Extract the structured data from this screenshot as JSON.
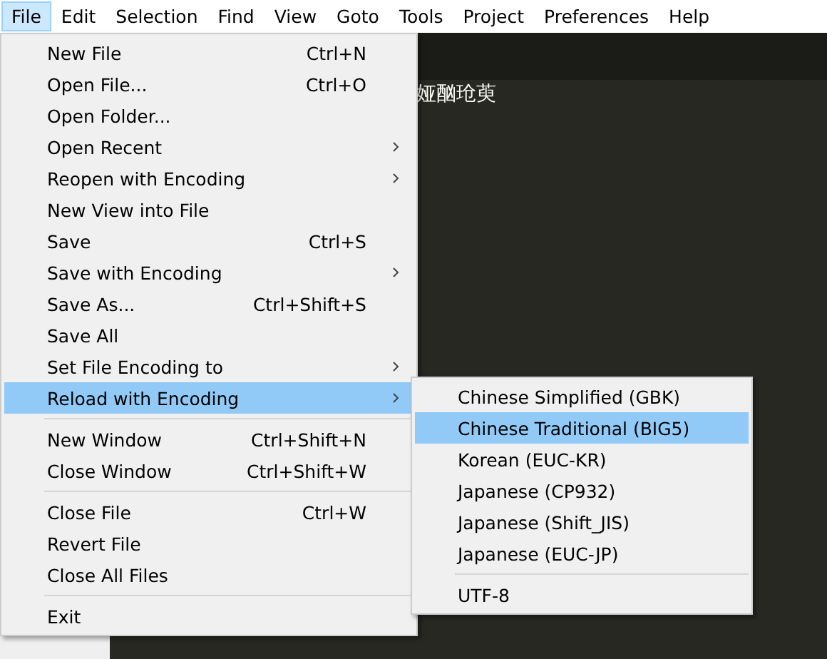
{
  "menubar": [
    {
      "label": "File",
      "selected": true
    },
    {
      "label": "Edit",
      "selected": false
    },
    {
      "label": "Selection",
      "selected": false
    },
    {
      "label": "Find",
      "selected": false
    },
    {
      "label": "View",
      "selected": false
    },
    {
      "label": "Goto",
      "selected": false
    },
    {
      "label": "Tools",
      "selected": false
    },
    {
      "label": "Project",
      "selected": false
    },
    {
      "label": "Preferences",
      "selected": false
    },
    {
      "label": "Help",
      "selected": false
    }
  ],
  "editor": {
    "text": "娅酗玱萸"
  },
  "file_menu": [
    {
      "kind": "item",
      "label": "New File",
      "shortcut": "Ctrl+N",
      "submenu": false,
      "selected": false
    },
    {
      "kind": "item",
      "label": "Open File...",
      "shortcut": "Ctrl+O",
      "submenu": false,
      "selected": false
    },
    {
      "kind": "item",
      "label": "Open Folder...",
      "submenu": false,
      "selected": false
    },
    {
      "kind": "item",
      "label": "Open Recent",
      "submenu": true,
      "selected": false
    },
    {
      "kind": "item",
      "label": "Reopen with Encoding",
      "submenu": true,
      "selected": false
    },
    {
      "kind": "item",
      "label": "New View into File",
      "submenu": false,
      "selected": false
    },
    {
      "kind": "item",
      "label": "Save",
      "shortcut": "Ctrl+S",
      "submenu": false,
      "selected": false
    },
    {
      "kind": "item",
      "label": "Save with Encoding",
      "submenu": true,
      "selected": false
    },
    {
      "kind": "item",
      "label": "Save As...",
      "shortcut": "Ctrl+Shift+S",
      "submenu": false,
      "selected": false
    },
    {
      "kind": "item",
      "label": "Save All",
      "submenu": false,
      "selected": false
    },
    {
      "kind": "item",
      "label": "Set File Encoding to",
      "submenu": true,
      "selected": false
    },
    {
      "kind": "item",
      "label": "Reload with Encoding",
      "submenu": true,
      "selected": true
    },
    {
      "kind": "separator"
    },
    {
      "kind": "item",
      "label": "New Window",
      "shortcut": "Ctrl+Shift+N",
      "submenu": false,
      "selected": false
    },
    {
      "kind": "item",
      "label": "Close Window",
      "shortcut": "Ctrl+Shift+W",
      "submenu": false,
      "selected": false
    },
    {
      "kind": "separator"
    },
    {
      "kind": "item",
      "label": "Close File",
      "shortcut": "Ctrl+W",
      "submenu": false,
      "selected": false
    },
    {
      "kind": "item",
      "label": "Revert File",
      "submenu": false,
      "selected": false
    },
    {
      "kind": "item",
      "label": "Close All Files",
      "submenu": false,
      "selected": false
    },
    {
      "kind": "separator"
    },
    {
      "kind": "item",
      "label": "Exit",
      "submenu": false,
      "selected": false
    }
  ],
  "encoding_submenu": [
    {
      "kind": "item",
      "label": "Chinese Simplified (GBK)",
      "selected": false
    },
    {
      "kind": "item",
      "label": "Chinese Traditional (BIG5)",
      "selected": true
    },
    {
      "kind": "item",
      "label": "Korean (EUC-KR)",
      "selected": false
    },
    {
      "kind": "item",
      "label": "Japanese (CP932)",
      "selected": false
    },
    {
      "kind": "item",
      "label": "Japanese (Shift_JIS)",
      "selected": false
    },
    {
      "kind": "item",
      "label": "Japanese (EUC-JP)",
      "selected": false
    },
    {
      "kind": "separator"
    },
    {
      "kind": "item",
      "label": "UTF-8",
      "selected": false
    }
  ]
}
